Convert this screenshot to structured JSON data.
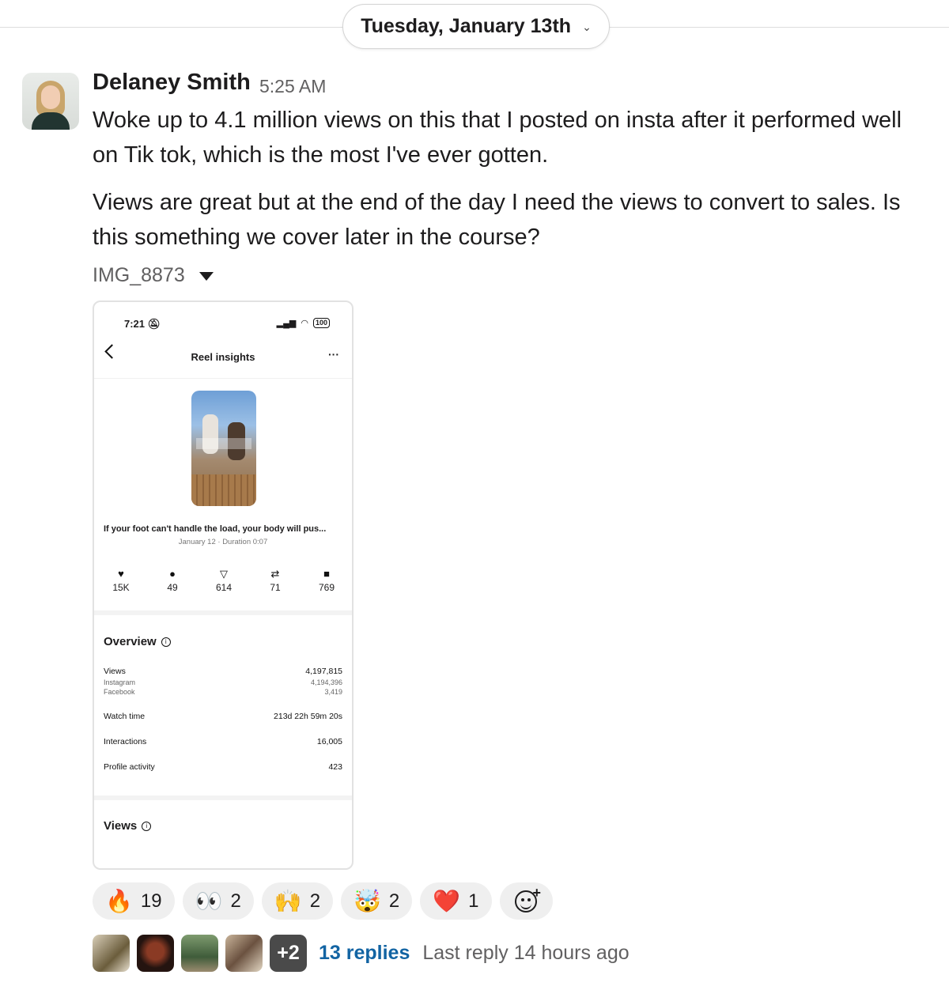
{
  "date_divider": {
    "label": "Tuesday, January 13th"
  },
  "message": {
    "author": "Delaney Smith",
    "time": "5:25 AM",
    "paragraph1": "Woke up to 4.1 million views on this that I posted on insta after it performed well on Tik tok, which is the most I've ever gotten.",
    "paragraph2": "Views are great but at the end of the day I need the views to convert to sales. Is this something we cover later in the course?",
    "attachment_name": "IMG_8873"
  },
  "screenshot": {
    "status_time": "7:21",
    "battery": "100",
    "title": "Reel insights",
    "more": "···",
    "caption": "If your foot can't handle the load, your body will pus...",
    "subcaption": "January 12 · Duration 0:07",
    "stats": [
      {
        "icon": "heart-icon",
        "glyph": "♥",
        "value": "15K"
      },
      {
        "icon": "comment-icon",
        "glyph": "●",
        "value": "49"
      },
      {
        "icon": "share-icon",
        "glyph": "▽",
        "value": "614"
      },
      {
        "icon": "repost-icon",
        "glyph": "⇄",
        "value": "71"
      },
      {
        "icon": "save-icon",
        "glyph": "■",
        "value": "769"
      }
    ],
    "overview_title": "Overview",
    "views_label": "Views",
    "views_value": "4,197,815",
    "instagram_label": "Instagram",
    "instagram_value": "4,194,396",
    "facebook_label": "Facebook",
    "facebook_value": "3,419",
    "watch_time_label": "Watch time",
    "watch_time_value": "213d 22h 59m 20s",
    "interactions_label": "Interactions",
    "interactions_value": "16,005",
    "profile_activity_label": "Profile activity",
    "profile_activity_value": "423",
    "views_section_title": "Views"
  },
  "reactions": [
    {
      "emoji": "🔥",
      "name": "fire-icon",
      "count": "19"
    },
    {
      "emoji": "👀",
      "name": "eyes-icon",
      "count": "2"
    },
    {
      "emoji": "🙌",
      "name": "raised-hands-icon",
      "count": "2"
    },
    {
      "emoji": "🤯",
      "name": "mind-blown-icon",
      "count": "2"
    },
    {
      "emoji": "❤️",
      "name": "red-heart-icon",
      "count": "1"
    }
  ],
  "thread": {
    "extra_avatars": "+2",
    "replies": "13 replies",
    "last_reply": "Last reply 14 hours ago"
  }
}
